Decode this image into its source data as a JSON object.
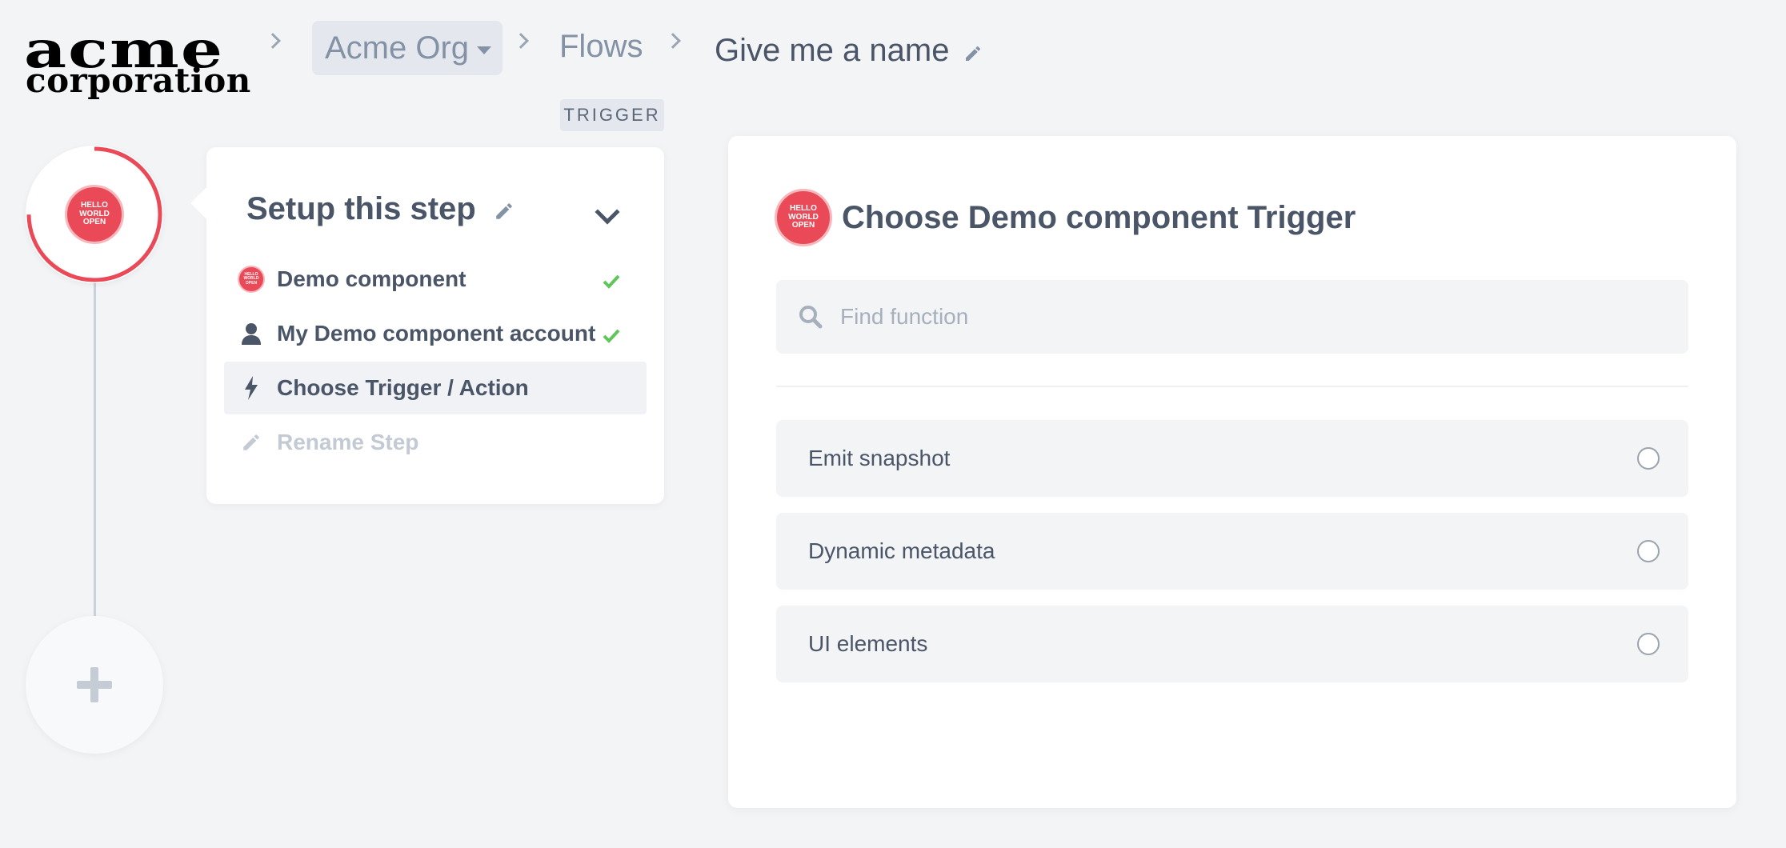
{
  "header": {
    "logo_line1": "acme",
    "logo_line2": "corporation",
    "org_label": "Acme Org",
    "flows_label": "Flows",
    "flow_name": "Give me a name"
  },
  "trigger_badge": "TRIGGER",
  "component_logo": {
    "line1": "HELLO",
    "line2": "WORLD",
    "line3": "OPEN"
  },
  "setup": {
    "title": "Setup this step",
    "steps": [
      {
        "label": "Demo component",
        "icon": "component-logo-icon",
        "done": true
      },
      {
        "label": "My Demo component account",
        "icon": "user-icon",
        "done": true
      },
      {
        "label": "Choose Trigger / Action",
        "icon": "bolt-icon",
        "active": true
      },
      {
        "label": "Rename Step",
        "icon": "pencil-icon",
        "disabled": true
      }
    ]
  },
  "panel": {
    "title": "Choose Demo component Trigger",
    "search_placeholder": "Find function",
    "functions": [
      "Emit snapshot",
      "Dynamic metadata",
      "UI elements"
    ]
  },
  "colors": {
    "accent_red": "#ea4a57",
    "check_green": "#5fc65a",
    "text_dark": "#4a5568",
    "text_muted": "#8492a6"
  }
}
